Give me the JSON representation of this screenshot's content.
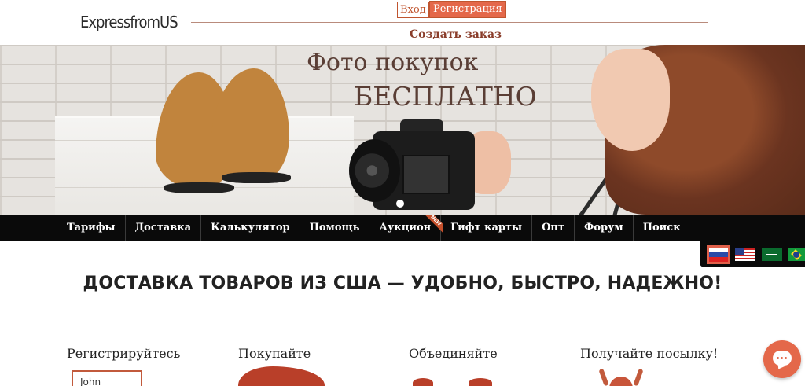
{
  "header": {
    "logo_text": "ExpressfromUS",
    "login_label": "Вход",
    "register_label": "Регистрация",
    "create_order_label": "Создать заказ"
  },
  "hero": {
    "title_line1": "Фото покупок",
    "title_line2": "БЕСПЛАТНО"
  },
  "nav": {
    "items": [
      {
        "label": "Тарифы"
      },
      {
        "label": "Доставка"
      },
      {
        "label": "Калькулятор"
      },
      {
        "label": "Помощь"
      },
      {
        "label": "Аукцион",
        "badge": "NEW"
      },
      {
        "label": "Гифт карты"
      },
      {
        "label": "Опт"
      },
      {
        "label": "Форум"
      },
      {
        "label": "Поиск"
      }
    ]
  },
  "languages": {
    "selected": "ru",
    "flags": [
      "ru-flag-icon",
      "us-flag-icon",
      "sa-flag-icon",
      "br-flag-icon"
    ]
  },
  "main": {
    "heading": "ДОСТАВКА ТОВАРОВ ИЗ США — УДОБНО, БЫСТРО, НАДЕЖНО!",
    "steps": [
      {
        "title": "Регистрируйтесь"
      },
      {
        "title": "Покупайте"
      },
      {
        "title": "Объединяйте"
      },
      {
        "title": "Получайте посылку!"
      }
    ],
    "register_illustration_text": "John"
  },
  "colors": {
    "accent": "#e4684a",
    "accent_dark": "#8a3d2a",
    "nav_background": "#0a0a0a",
    "hero_text": "#5a3e35"
  }
}
